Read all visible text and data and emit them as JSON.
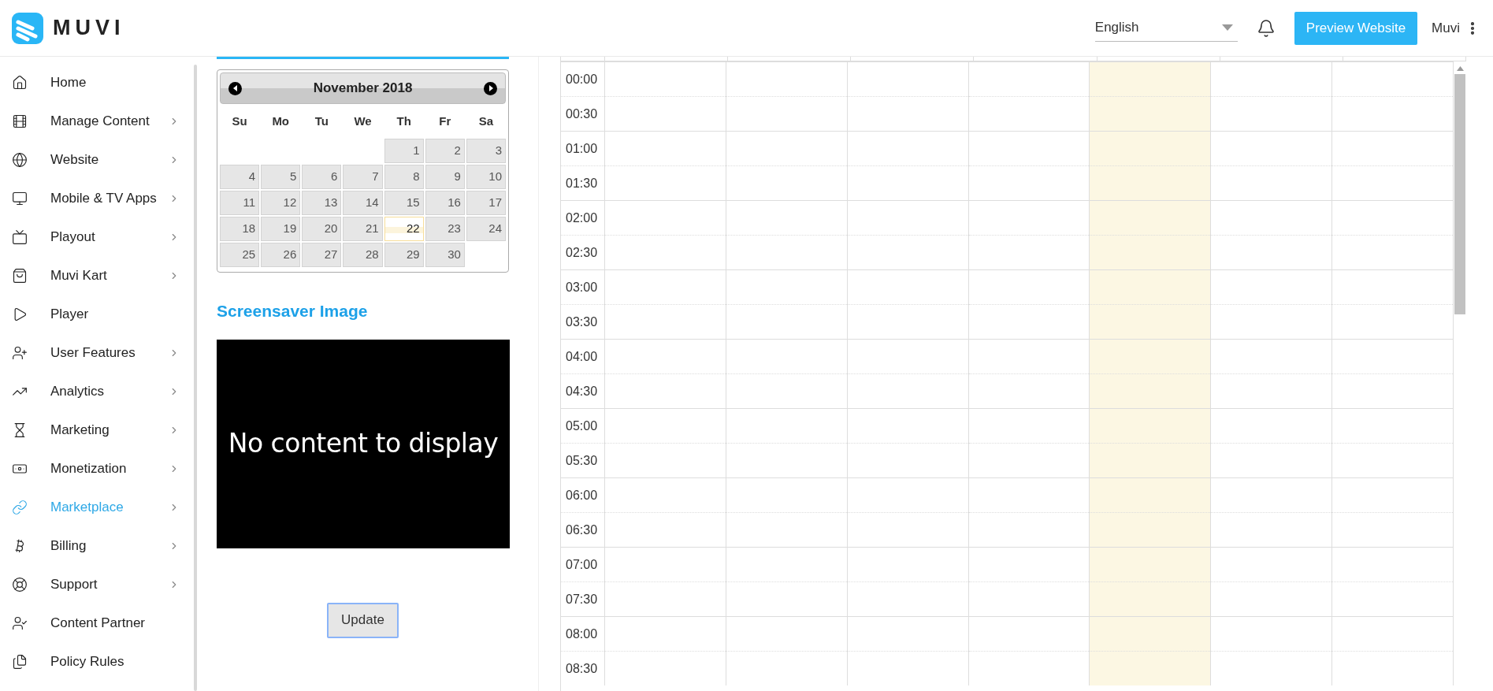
{
  "header": {
    "logo_text": "MUVI",
    "language": {
      "value": "English"
    },
    "preview_button": "Preview Website",
    "user_name": "Muvi"
  },
  "sidebar": {
    "items": [
      {
        "label": "Home",
        "expandable": false,
        "selected": false
      },
      {
        "label": "Manage Content",
        "expandable": true,
        "selected": false
      },
      {
        "label": "Website",
        "expandable": true,
        "selected": false
      },
      {
        "label": "Mobile & TV Apps",
        "expandable": true,
        "selected": false
      },
      {
        "label": "Playout",
        "expandable": true,
        "selected": false
      },
      {
        "label": "Muvi Kart",
        "expandable": true,
        "selected": false
      },
      {
        "label": "Player",
        "expandable": false,
        "selected": false
      },
      {
        "label": "User Features",
        "expandable": true,
        "selected": false
      },
      {
        "label": "Analytics",
        "expandable": true,
        "selected": false
      },
      {
        "label": "Marketing",
        "expandable": true,
        "selected": false
      },
      {
        "label": "Monetization",
        "expandable": true,
        "selected": false
      },
      {
        "label": "Marketplace",
        "expandable": true,
        "selected": true
      },
      {
        "label": "Billing",
        "expandable": true,
        "selected": false
      },
      {
        "label": "Support",
        "expandable": true,
        "selected": false
      },
      {
        "label": "Content Partner",
        "expandable": false,
        "selected": false
      },
      {
        "label": "Policy Rules",
        "expandable": false,
        "selected": false
      }
    ]
  },
  "calendar": {
    "title": "November 2018",
    "weekdays": [
      "Su",
      "Mo",
      "Tu",
      "We",
      "Th",
      "Fr",
      "Sa"
    ],
    "weeks": [
      [
        {
          "kind": "empty"
        },
        {
          "kind": "empty"
        },
        {
          "kind": "empty"
        },
        {
          "kind": "empty"
        },
        {
          "label": "1",
          "today": false
        },
        {
          "label": "2",
          "today": false
        },
        {
          "label": "3",
          "today": false
        }
      ],
      [
        {
          "label": "4",
          "today": false
        },
        {
          "label": "5",
          "today": false
        },
        {
          "label": "6",
          "today": false
        },
        {
          "label": "7",
          "today": false
        },
        {
          "label": "8",
          "today": false
        },
        {
          "label": "9",
          "today": false
        },
        {
          "label": "10",
          "today": false
        }
      ],
      [
        {
          "label": "11",
          "today": false
        },
        {
          "label": "12",
          "today": false
        },
        {
          "label": "13",
          "today": false
        },
        {
          "label": "14",
          "today": false
        },
        {
          "label": "15",
          "today": false
        },
        {
          "label": "16",
          "today": false
        },
        {
          "label": "17",
          "today": false
        }
      ],
      [
        {
          "label": "18",
          "today": false
        },
        {
          "label": "19",
          "today": false
        },
        {
          "label": "20",
          "today": false
        },
        {
          "label": "21",
          "today": false
        },
        {
          "label": "22",
          "today": true
        },
        {
          "label": "23",
          "today": false
        },
        {
          "label": "24",
          "today": false
        }
      ],
      [
        {
          "label": "25",
          "today": false
        },
        {
          "label": "26",
          "today": false
        },
        {
          "label": "27",
          "today": false
        },
        {
          "label": "28",
          "today": false
        },
        {
          "label": "29",
          "today": false
        },
        {
          "label": "30",
          "today": false
        },
        {
          "kind": "empty"
        }
      ]
    ]
  },
  "screensaver": {
    "heading": "Screensaver Image",
    "preview_text": "No content to display",
    "update_button": "Update"
  },
  "schedule": {
    "columns": [
      {
        "today": false
      },
      {
        "today": false
      },
      {
        "today": false
      },
      {
        "today": false
      },
      {
        "today": true
      },
      {
        "today": false
      },
      {
        "today": false
      }
    ],
    "times": [
      "00:00",
      "00:30",
      "01:00",
      "01:30",
      "02:00",
      "02:30",
      "03:00",
      "03:30",
      "04:00",
      "04:30",
      "05:00",
      "05:30",
      "06:00",
      "06:30",
      "07:00",
      "07:30",
      "08:00",
      "08:30"
    ]
  }
}
